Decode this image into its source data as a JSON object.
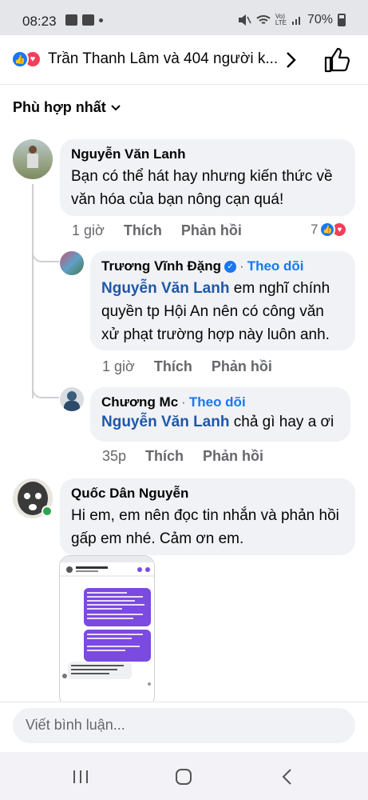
{
  "status_bar": {
    "time": "08:23",
    "battery": "70%",
    "icons": [
      "image-icon",
      "message-icon",
      "dot-icon",
      "mute-icon",
      "wifi-icon",
      "lte-icon",
      "signal-icon",
      "battery-icon"
    ]
  },
  "header": {
    "title": "Trần Thanh Lâm và 404 người k...",
    "reactions": [
      "like",
      "love"
    ]
  },
  "sort": {
    "label": "Phù hợp nhất"
  },
  "comments": [
    {
      "author": "Nguyễn Văn Lanh",
      "text": "Bạn có thể hát hay nhưng kiến thức về văn hóa của bạn nông cạn quá!",
      "time": "1 giờ",
      "like": "Thích",
      "reply": "Phản hồi",
      "reaction_count": "7"
    }
  ],
  "replies": [
    {
      "author": "Trương Vĩnh Đặng",
      "follow": "Theo dõi",
      "separator": "·",
      "mention": "Nguyễn Văn Lanh",
      "text": " em nghĩ chính quyền tp Hội An nên có công văn xử phạt trường hợp này luôn anh.",
      "time": "1 giờ",
      "like": "Thích",
      "reply": "Phản hồi"
    },
    {
      "author": "Chương Mc",
      "follow": "Theo dõi",
      "separator": "·",
      "mention": "Nguyễn Văn Lanh",
      "text": " chả gì hay a ơi",
      "time": "35p",
      "like": "Thích",
      "reply": "Phản hồi"
    }
  ],
  "comment2": {
    "author": "Quốc Dân Nguyễn",
    "text": "Hi em, em nên đọc tin nhắn và phản hồi gấp em nhé. Cảm ơn em."
  },
  "composer": {
    "placeholder": "Viết bình luận..."
  },
  "colors": {
    "link": "#1877f2",
    "mention": "#1f57a8",
    "bubble": "#f0f2f5",
    "love": "#f33e58"
  }
}
